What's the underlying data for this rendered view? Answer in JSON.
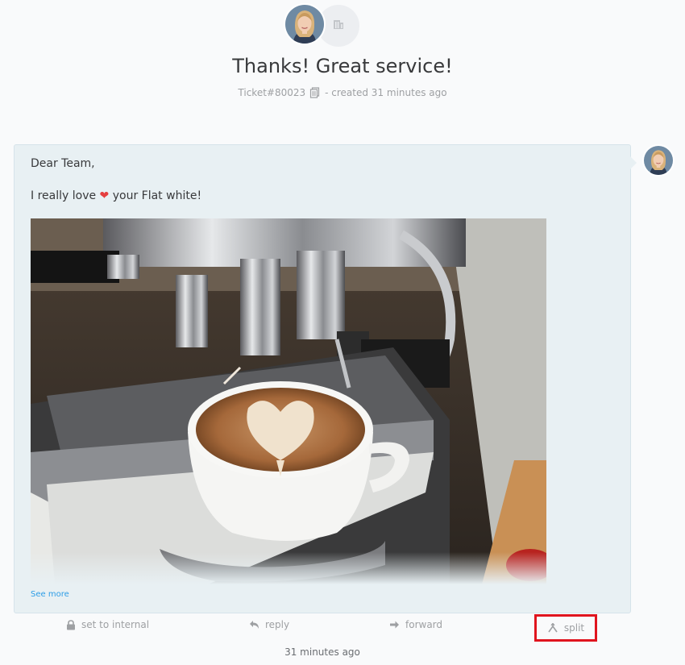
{
  "ticket": {
    "title": "Thanks! Great service!",
    "number": "Ticket#80023",
    "created": "- created 31 minutes ago"
  },
  "article": {
    "greeting": "Dear Team,",
    "body_before": "I really love",
    "heart": "❤",
    "body_after": "your Flat white!",
    "see_more": "See more",
    "timestamp": "31 minutes ago"
  },
  "actions": {
    "internal": "set to internal",
    "reply": "reply",
    "forward": "forward",
    "split": "split"
  },
  "colors": {
    "background": "#f9fafb",
    "article_bg": "#e8f0f3",
    "link": "#2d9de6",
    "highlight": "#e0141e",
    "heart": "#e53f3f"
  },
  "icons": [
    "org-icon",
    "copy-icon",
    "lock-icon",
    "reply-icon",
    "forward-icon",
    "split-icon"
  ]
}
